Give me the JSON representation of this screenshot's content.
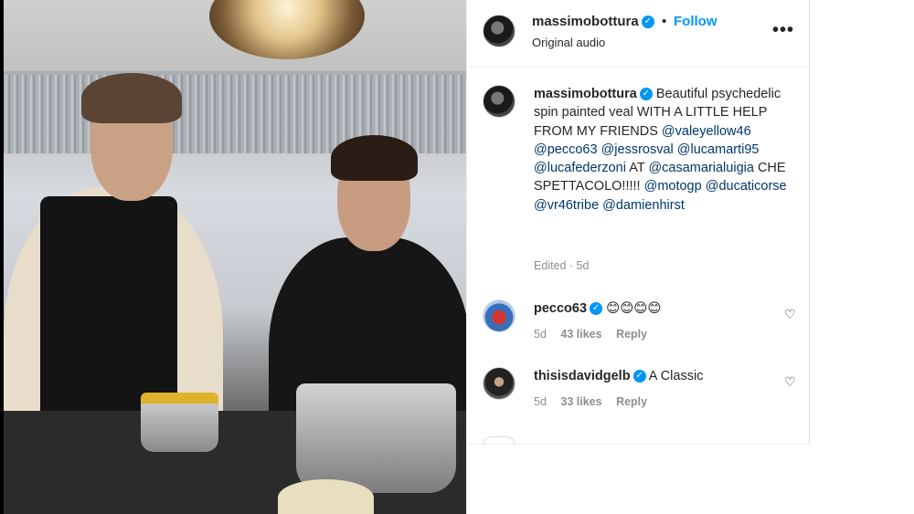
{
  "post": {
    "username": "massimobottura",
    "follow_label": "Follow",
    "separator": "•",
    "audio": "Original audio",
    "more_icon": "more-horizontal-icon",
    "verified_icon": "verified-badge-icon"
  },
  "caption": {
    "username": "massimobottura",
    "text_1": "Beautiful psychedelic spin painted veal WITH A LITTLE HELP FROM MY FRIENDS",
    "mentions_1": [
      "@valeyellow46",
      "@pecco63",
      "@jessrosval",
      "@lucamarti95",
      "@lucafederzoni"
    ],
    "text_2": "AT",
    "mention_2": "@casamarialuigia",
    "text_3": "CHE SPETTACOLO!!!!!",
    "mentions_3": [
      "@motogp",
      "@ducaticorse",
      "@vr46tribe",
      "@damienhirst"
    ],
    "meta": "Edited · 5d"
  },
  "comments": [
    {
      "username": "pecco63",
      "text": "😊😊😊😊",
      "age": "5d",
      "likes": "43 likes",
      "reply": "Reply"
    },
    {
      "username": "thisisdavidgelb",
      "text": "A Classic",
      "age": "5d",
      "likes": "33 likes",
      "reply": "Reply"
    }
  ],
  "colors": {
    "accent": "#0095f6",
    "mention": "#00376b",
    "muted": "#8e8e8e",
    "text": "#262626"
  }
}
